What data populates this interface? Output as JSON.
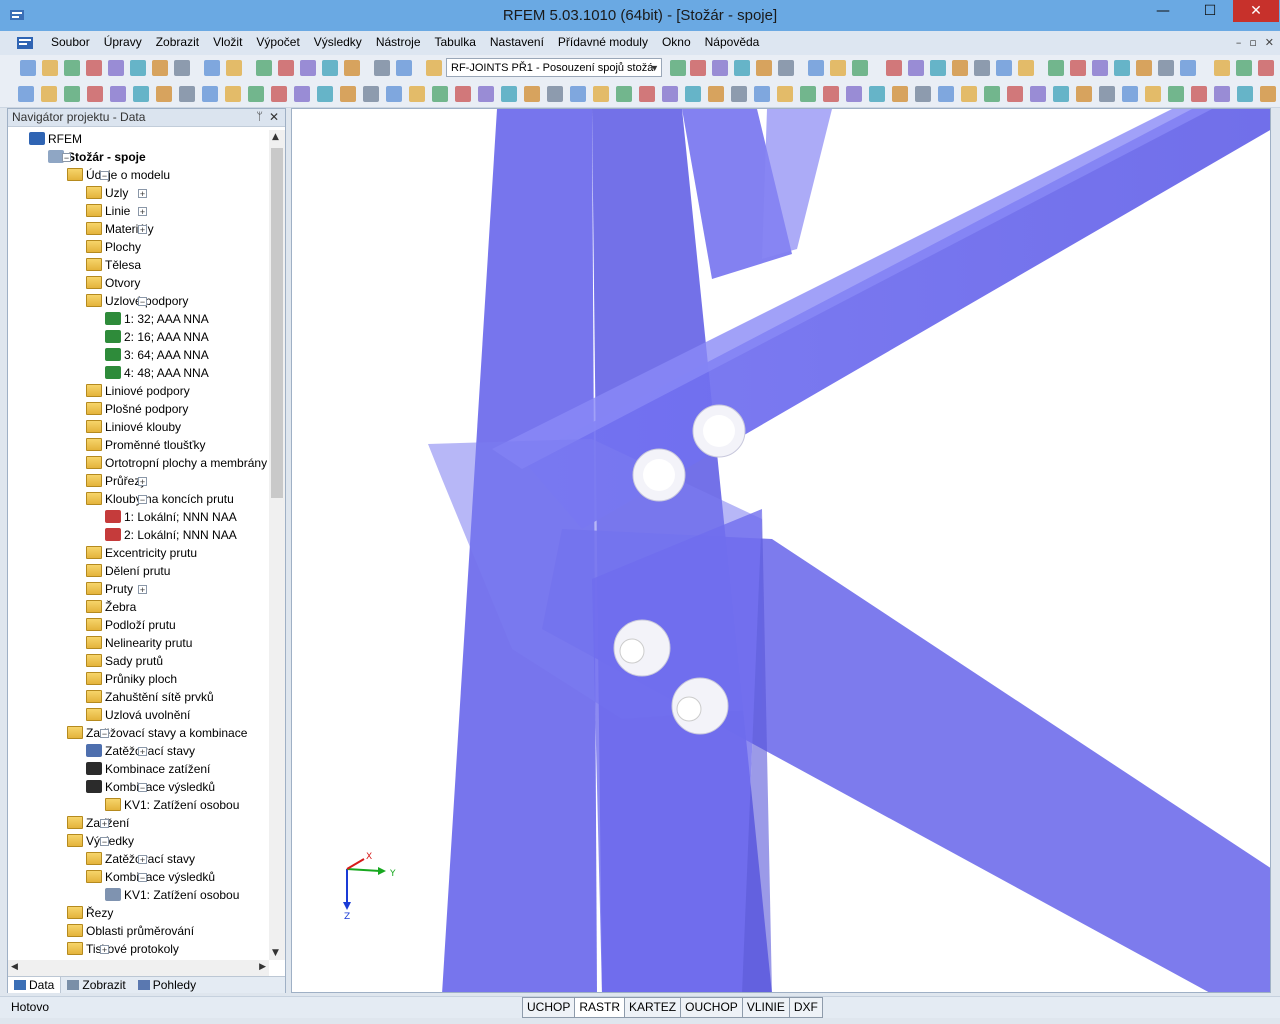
{
  "window": {
    "title": "RFEM 5.03.1010 (64bit) - [Stožár - spoje]",
    "minimize": "—",
    "maximize": "☐",
    "close": "✕"
  },
  "menu": {
    "items": [
      "Soubor",
      "Úpravy",
      "Zobrazit",
      "Vložit",
      "Výpočet",
      "Výsledky",
      "Nástroje",
      "Tabulka",
      "Nastavení",
      "Přídavné moduly",
      "Okno",
      "Nápověda"
    ],
    "mdi": [
      "–",
      "▫",
      "✕"
    ]
  },
  "toolbar": {
    "module_combo": "RF-JOINTS PŘ1 - Posouzení spojů stožá"
  },
  "navigator": {
    "title": "Navigátor projektu - Data",
    "pin": "ᛘ",
    "close": "✕",
    "tree": [
      {
        "label": "RFEM",
        "level": 0,
        "icon": "rfem-logo-icon",
        "exp": ""
      },
      {
        "label": "Stožár - spoje",
        "level": 1,
        "icon": "model-icon",
        "exp": "−",
        "bold": true
      },
      {
        "label": "Údaje o modelu",
        "level": 2,
        "icon": "folder-icon",
        "exp": "−"
      },
      {
        "label": "Uzly",
        "level": 3,
        "icon": "folder-icon",
        "exp": "+"
      },
      {
        "label": "Linie",
        "level": 3,
        "icon": "folder-icon",
        "exp": "+"
      },
      {
        "label": "Materiály",
        "level": 3,
        "icon": "folder-icon",
        "exp": "+"
      },
      {
        "label": "Plochy",
        "level": 3,
        "icon": "folder-icon",
        "exp": ""
      },
      {
        "label": "Tělesa",
        "level": 3,
        "icon": "folder-icon",
        "exp": ""
      },
      {
        "label": "Otvory",
        "level": 3,
        "icon": "folder-icon",
        "exp": ""
      },
      {
        "label": "Uzlové podpory",
        "level": 3,
        "icon": "folder-icon",
        "exp": "−"
      },
      {
        "label": "1: 32; AAA NNA",
        "level": 4,
        "icon": "support-icon",
        "exp": ""
      },
      {
        "label": "2: 16; AAA NNA",
        "level": 4,
        "icon": "support-icon",
        "exp": ""
      },
      {
        "label": "3: 64; AAA NNA",
        "level": 4,
        "icon": "support-icon",
        "exp": ""
      },
      {
        "label": "4: 48; AAA NNA",
        "level": 4,
        "icon": "support-icon",
        "exp": ""
      },
      {
        "label": "Liniové podpory",
        "level": 3,
        "icon": "folder-icon",
        "exp": ""
      },
      {
        "label": "Plošné podpory",
        "level": 3,
        "icon": "folder-icon",
        "exp": ""
      },
      {
        "label": "Liniové klouby",
        "level": 3,
        "icon": "folder-icon",
        "exp": ""
      },
      {
        "label": "Proměnné tloušťky",
        "level": 3,
        "icon": "folder-icon",
        "exp": ""
      },
      {
        "label": "Ortotropní plochy a membrány",
        "level": 3,
        "icon": "folder-icon",
        "exp": ""
      },
      {
        "label": "Průřezy",
        "level": 3,
        "icon": "folder-icon",
        "exp": "+"
      },
      {
        "label": "Klouby na koncích prutu",
        "level": 3,
        "icon": "folder-icon",
        "exp": "−"
      },
      {
        "label": "1: Lokální; NNN NAA",
        "level": 4,
        "icon": "hinge-icon",
        "exp": ""
      },
      {
        "label": "2: Lokální; NNN NAA",
        "level": 4,
        "icon": "hinge-icon",
        "exp": ""
      },
      {
        "label": "Excentricity prutu",
        "level": 3,
        "icon": "folder-icon",
        "exp": ""
      },
      {
        "label": "Dělení prutu",
        "level": 3,
        "icon": "folder-icon",
        "exp": ""
      },
      {
        "label": "Pruty",
        "level": 3,
        "icon": "folder-icon",
        "exp": "+"
      },
      {
        "label": "Žebra",
        "level": 3,
        "icon": "folder-icon",
        "exp": ""
      },
      {
        "label": "Podloží prutu",
        "level": 3,
        "icon": "folder-icon",
        "exp": ""
      },
      {
        "label": "Nelinearity prutu",
        "level": 3,
        "icon": "folder-icon",
        "exp": ""
      },
      {
        "label": "Sady prutů",
        "level": 3,
        "icon": "folder-icon",
        "exp": ""
      },
      {
        "label": "Průniky ploch",
        "level": 3,
        "icon": "folder-icon",
        "exp": ""
      },
      {
        "label": "Zahuštění sítě prvků",
        "level": 3,
        "icon": "folder-icon",
        "exp": ""
      },
      {
        "label": "Uzlová uvolnění",
        "level": 3,
        "icon": "folder-icon",
        "exp": ""
      },
      {
        "label": "Zatěžovací stavy a kombinace",
        "level": 2,
        "icon": "folder-icon",
        "exp": "−"
      },
      {
        "label": "Zatěžovací stavy",
        "level": 3,
        "icon": "load-case-icon",
        "exp": "+"
      },
      {
        "label": "Kombinace zatížení",
        "level": 3,
        "icon": "combination-icon",
        "exp": ""
      },
      {
        "label": "Kombinace výsledků",
        "level": 3,
        "icon": "combination-icon",
        "exp": "−"
      },
      {
        "label": "KV1: Zatížení osobou",
        "level": 4,
        "icon": "folder-icon",
        "exp": ""
      },
      {
        "label": "Zatížení",
        "level": 2,
        "icon": "folder-icon",
        "exp": "+"
      },
      {
        "label": "Výsledky",
        "level": 2,
        "icon": "folder-icon",
        "exp": "−"
      },
      {
        "label": "Zatěžovací stavy",
        "level": 3,
        "icon": "folder-icon",
        "exp": "+"
      },
      {
        "label": "Kombinace výsledků",
        "level": 3,
        "icon": "folder-icon",
        "exp": "−"
      },
      {
        "label": "KV1: Zatížení osobou",
        "level": 4,
        "icon": "result-icon",
        "exp": ""
      },
      {
        "label": "Řezy",
        "level": 2,
        "icon": "folder-icon",
        "exp": ""
      },
      {
        "label": "Oblasti průměrování",
        "level": 2,
        "icon": "folder-icon",
        "exp": ""
      },
      {
        "label": "Tiskové protokoly",
        "level": 2,
        "icon": "folder-icon",
        "exp": "+"
      }
    ],
    "tabs": [
      "Data",
      "Zobrazit",
      "Pohledy"
    ]
  },
  "axes": {
    "x": "X",
    "y": "Y",
    "z": "Z"
  },
  "colors": {
    "member": "#6f6cf0",
    "member_dark": "#5a58de",
    "bolt": "#f2f2f8",
    "bg": "#ffffff"
  },
  "status": {
    "text": "Hotovo",
    "buttons": [
      "UCHOP",
      "RASTR",
      "KARTEZ",
      "OUCHOP",
      "VLINIE",
      "DXF"
    ],
    "active": "RASTR"
  }
}
